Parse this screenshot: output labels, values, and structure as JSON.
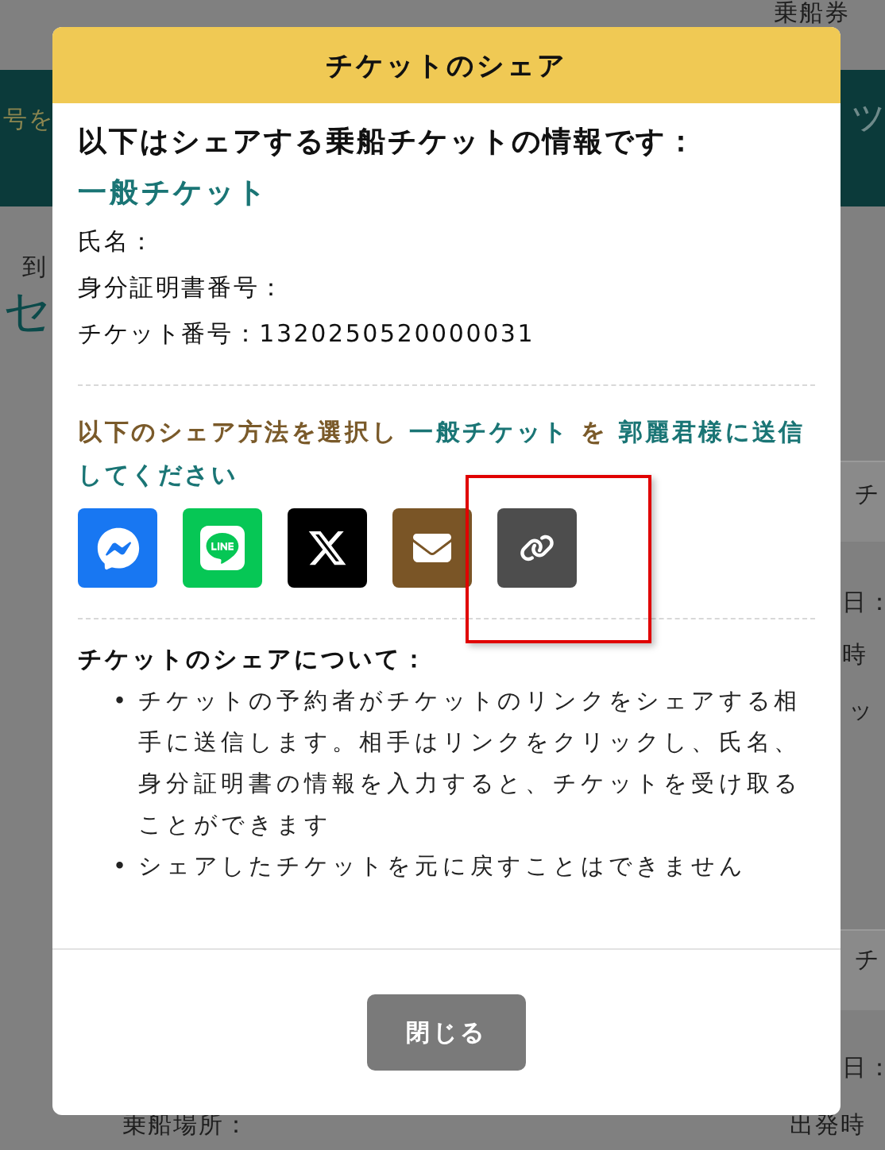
{
  "background_page": {
    "fragments": [
      {
        "kind": "heading",
        "text": "乗船券"
      },
      {
        "kind": "band-left",
        "text": "号を"
      },
      {
        "kind": "band-right",
        "text": "ッ"
      },
      {
        "kind": "small",
        "text": "到"
      },
      {
        "kind": "big",
        "text": "セ"
      },
      {
        "kind": "small",
        "text": "チ"
      },
      {
        "kind": "small",
        "text": "日："
      },
      {
        "kind": "small",
        "text": "時"
      },
      {
        "kind": "small",
        "text": "ッ"
      },
      {
        "kind": "small",
        "text": "チ"
      },
      {
        "kind": "small",
        "text": "日："
      },
      {
        "kind": "small",
        "text": "出発時"
      },
      {
        "kind": "small",
        "text": "乗船場所："
      }
    ]
  },
  "dialog": {
    "title": "チケットのシェア",
    "intro": "以下はシェアする乗船チケットの情報です：",
    "ticket_type": "一般チケット",
    "fields": [
      {
        "label": "氏名："
      },
      {
        "label": "身分証明書番号："
      },
      {
        "label": "チケット番号：",
        "value": "1320250520000031"
      }
    ],
    "instruction": [
      {
        "kind": "plain",
        "text": "以下のシェア方法を選択し "
      },
      {
        "kind": "accent",
        "text": "一般チケット"
      },
      {
        "kind": "plain",
        "text": " を "
      },
      {
        "kind": "accent",
        "text": "郭麗君様に送信してください"
      }
    ],
    "share_options": [
      {
        "kind": "messenger",
        "color": "#1877f2",
        "highlighted": false
      },
      {
        "kind": "line",
        "color": "#06c755",
        "highlighted": false
      },
      {
        "kind": "x",
        "color": "#000000",
        "highlighted": false
      },
      {
        "kind": "mail",
        "color": "#7a5526",
        "highlighted": false
      },
      {
        "kind": "link",
        "color": "#4d4d4d",
        "highlighted": true
      }
    ],
    "notes_title": "チケットのシェアについて：",
    "notes": [
      {
        "marker": "•",
        "text": "チケットの予約者がチケットのリンクをシェアする相手に送信します。相手はリンクをクリックし、氏名、身分証明書の情報を入力すると、チケットを受け取ることができます"
      },
      {
        "marker": "•",
        "text": "シェアしたチケットを元に戻すことはできません"
      }
    ],
    "close_button": "閉じる"
  }
}
